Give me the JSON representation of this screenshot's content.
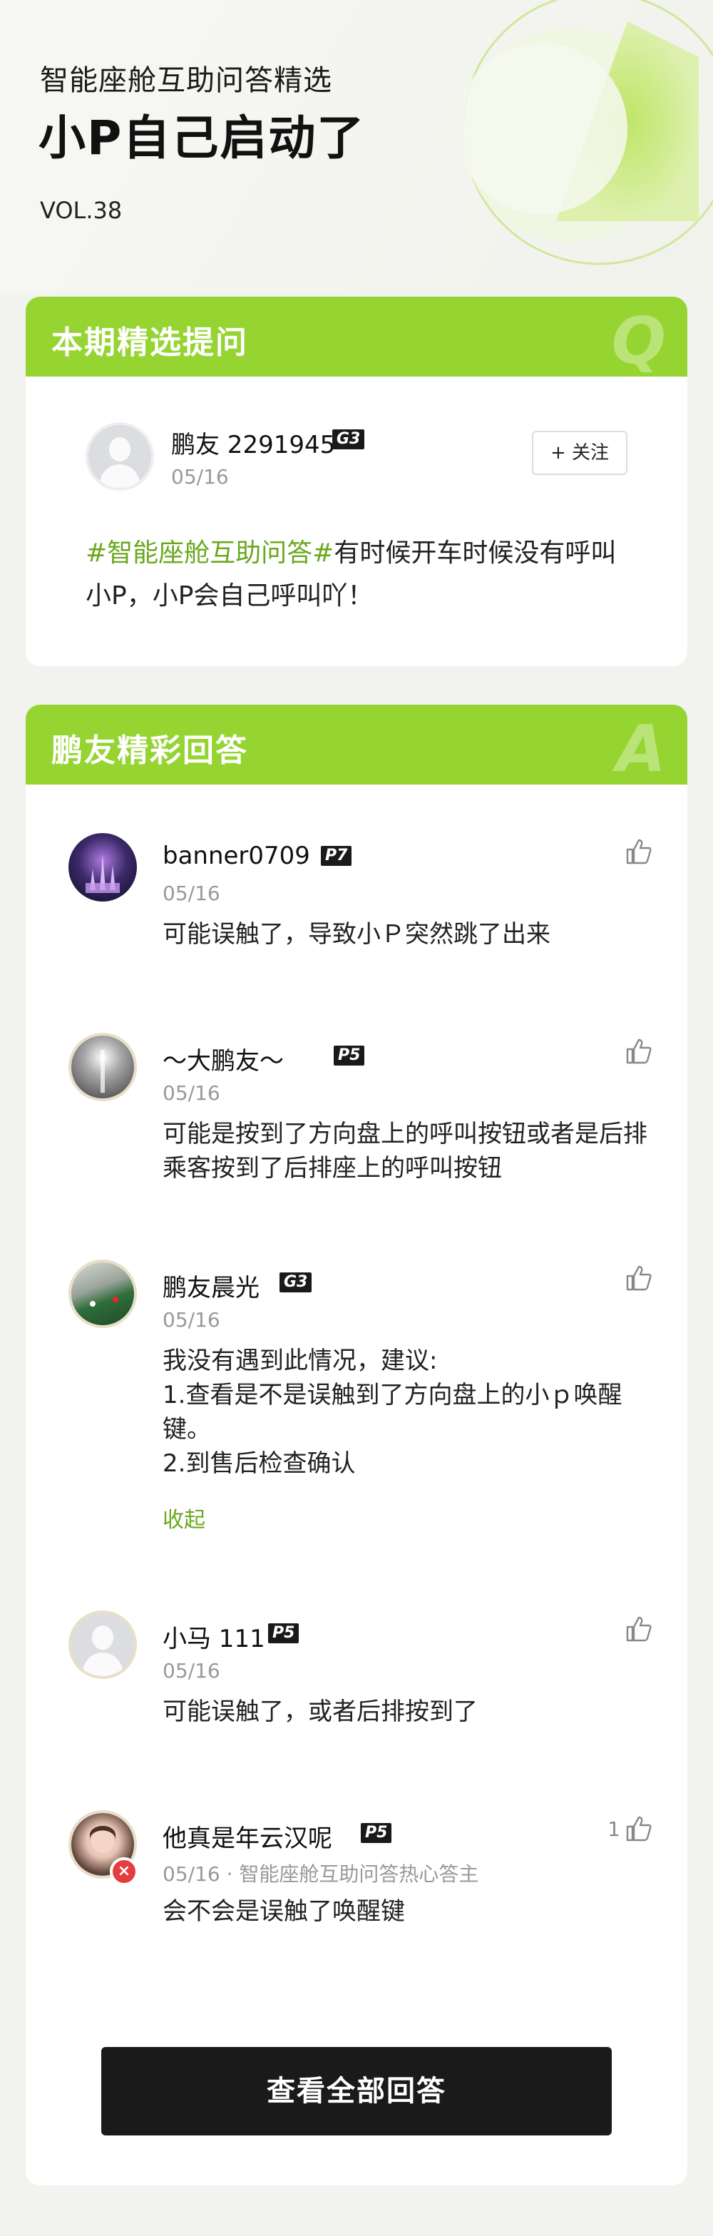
{
  "hero": {
    "subtitle": "智能座舱互助问答精选",
    "title": "小P自己启动了",
    "vol": "VOL.38",
    "accent_color": "#95d431"
  },
  "question_card": {
    "header": "本期精选提问",
    "letter": "Q",
    "user": {
      "name": "鹏友 2291945",
      "badge": "G3",
      "date": "05/16",
      "avatar_icon": "default-avatar-icon"
    },
    "follow_label": "+ 关注",
    "hashtag": "#智能座舱互助问答#",
    "text": "有时候开车时候没有呼叫小P，小P会自己呼叫吖！"
  },
  "answer_card": {
    "header": "鹏友精彩回答",
    "letter": "A",
    "answers": [
      {
        "name": "banner0709",
        "badge": "P7",
        "date": "05/16",
        "text": "可能误触了，导致小Ｐ突然跳了出来",
        "avatar_icon": "castle-photo-avatar"
      },
      {
        "name": "～大鹏友～",
        "badge": "P5",
        "date": "05/16",
        "text": "可能是按到了方向盘上的呼叫按钮或者是后排乘客按到了后排座上的呼叫按钮",
        "avatar_icon": "light-photo-avatar"
      },
      {
        "name": "鹏友晨光",
        "badge": "G3",
        "date": "05/16",
        "text_lines": [
          "我没有遇到此情况，建议:",
          "1.查看是不是误触到了方向盘上的小ｐ唤醒键。",
          "2.到售后检查确认"
        ],
        "collapse": "收起",
        "avatar_icon": "billiards-photo-avatar"
      },
      {
        "name": "小马 111",
        "badge": "P5",
        "date": "05/16",
        "text": "可能误触了，或者后排按到了",
        "avatar_icon": "default-avatar-icon"
      },
      {
        "name": "他真是年云汉呢",
        "badge": "P5",
        "date": "05/16 · 智能座舱互助问答热心答主",
        "text": "会不会是误触了唤醒键",
        "likes": "1",
        "avatar_icon": "girl-photo-avatar"
      }
    ],
    "view_all": "查看全部回答"
  }
}
